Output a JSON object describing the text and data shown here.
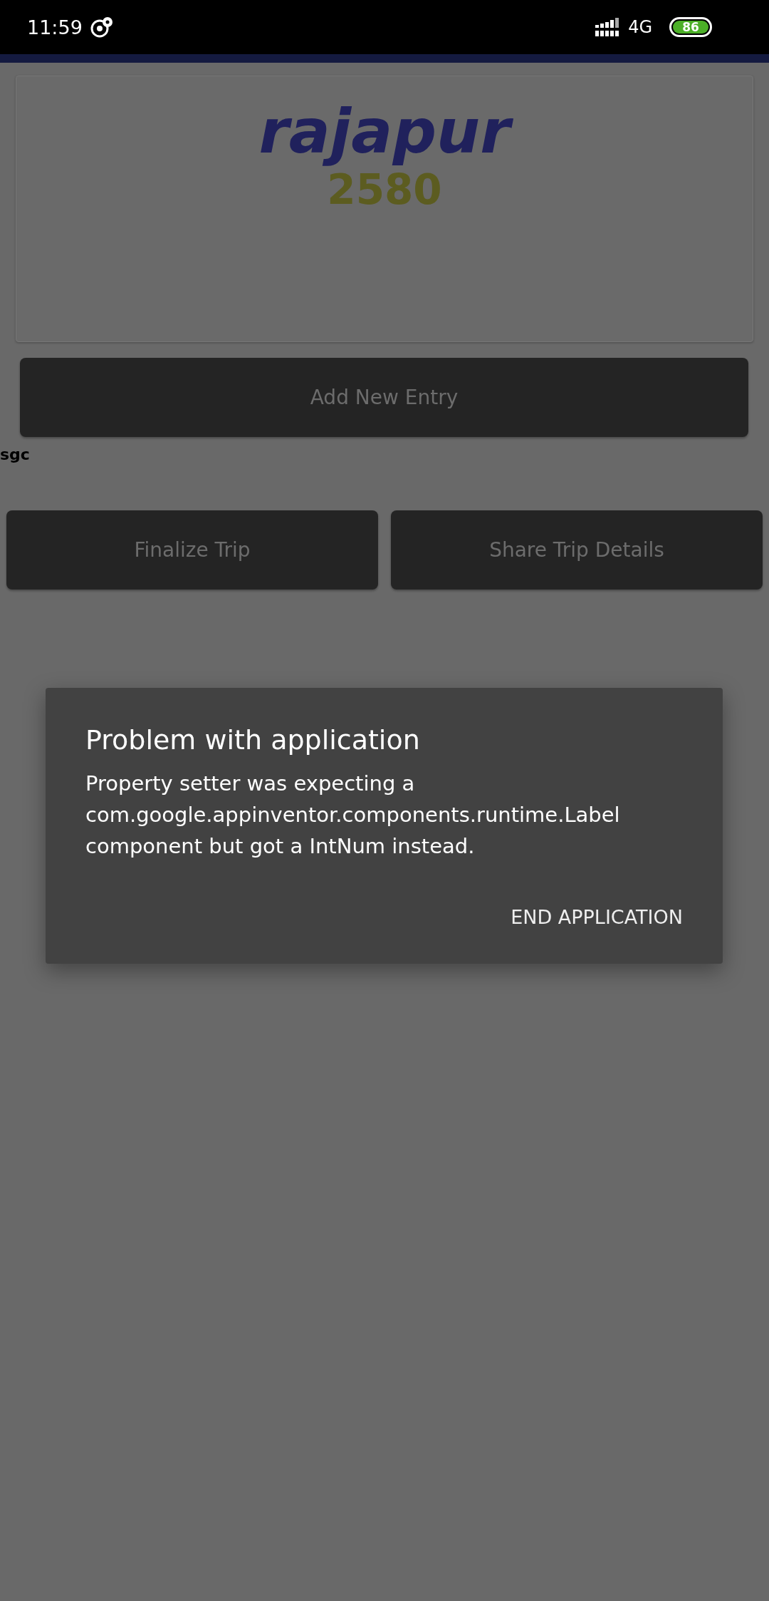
{
  "status_bar": {
    "time": "11:59",
    "network": "4G",
    "battery": "86"
  },
  "card": {
    "title": "rajapur",
    "count": "2580"
  },
  "add_button": "Add New Entry",
  "label": "sgc",
  "actions": [
    {
      "label": "Finalize Trip"
    },
    {
      "label": "Share Trip Details"
    }
  ],
  "dialog": {
    "title": "Problem with application",
    "message": "Property setter was expecting a com.google.appinventor.components.runtime.Label component but got a IntNum instead.",
    "button": "END APPLICATION"
  }
}
